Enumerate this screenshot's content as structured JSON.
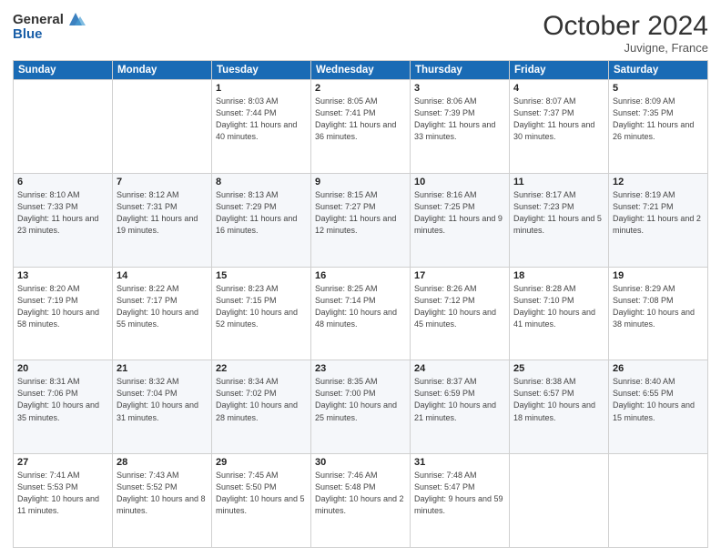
{
  "header": {
    "logo_line1": "General",
    "logo_line2": "Blue",
    "month": "October 2024",
    "location": "Juvigne, France"
  },
  "weekdays": [
    "Sunday",
    "Monday",
    "Tuesday",
    "Wednesday",
    "Thursday",
    "Friday",
    "Saturday"
  ],
  "weeks": [
    [
      {
        "day": "",
        "info": ""
      },
      {
        "day": "",
        "info": ""
      },
      {
        "day": "1",
        "info": "Sunrise: 8:03 AM\nSunset: 7:44 PM\nDaylight: 11 hours and 40 minutes."
      },
      {
        "day": "2",
        "info": "Sunrise: 8:05 AM\nSunset: 7:41 PM\nDaylight: 11 hours and 36 minutes."
      },
      {
        "day": "3",
        "info": "Sunrise: 8:06 AM\nSunset: 7:39 PM\nDaylight: 11 hours and 33 minutes."
      },
      {
        "day": "4",
        "info": "Sunrise: 8:07 AM\nSunset: 7:37 PM\nDaylight: 11 hours and 30 minutes."
      },
      {
        "day": "5",
        "info": "Sunrise: 8:09 AM\nSunset: 7:35 PM\nDaylight: 11 hours and 26 minutes."
      }
    ],
    [
      {
        "day": "6",
        "info": "Sunrise: 8:10 AM\nSunset: 7:33 PM\nDaylight: 11 hours and 23 minutes."
      },
      {
        "day": "7",
        "info": "Sunrise: 8:12 AM\nSunset: 7:31 PM\nDaylight: 11 hours and 19 minutes."
      },
      {
        "day": "8",
        "info": "Sunrise: 8:13 AM\nSunset: 7:29 PM\nDaylight: 11 hours and 16 minutes."
      },
      {
        "day": "9",
        "info": "Sunrise: 8:15 AM\nSunset: 7:27 PM\nDaylight: 11 hours and 12 minutes."
      },
      {
        "day": "10",
        "info": "Sunrise: 8:16 AM\nSunset: 7:25 PM\nDaylight: 11 hours and 9 minutes."
      },
      {
        "day": "11",
        "info": "Sunrise: 8:17 AM\nSunset: 7:23 PM\nDaylight: 11 hours and 5 minutes."
      },
      {
        "day": "12",
        "info": "Sunrise: 8:19 AM\nSunset: 7:21 PM\nDaylight: 11 hours and 2 minutes."
      }
    ],
    [
      {
        "day": "13",
        "info": "Sunrise: 8:20 AM\nSunset: 7:19 PM\nDaylight: 10 hours and 58 minutes."
      },
      {
        "day": "14",
        "info": "Sunrise: 8:22 AM\nSunset: 7:17 PM\nDaylight: 10 hours and 55 minutes."
      },
      {
        "day": "15",
        "info": "Sunrise: 8:23 AM\nSunset: 7:15 PM\nDaylight: 10 hours and 52 minutes."
      },
      {
        "day": "16",
        "info": "Sunrise: 8:25 AM\nSunset: 7:14 PM\nDaylight: 10 hours and 48 minutes."
      },
      {
        "day": "17",
        "info": "Sunrise: 8:26 AM\nSunset: 7:12 PM\nDaylight: 10 hours and 45 minutes."
      },
      {
        "day": "18",
        "info": "Sunrise: 8:28 AM\nSunset: 7:10 PM\nDaylight: 10 hours and 41 minutes."
      },
      {
        "day": "19",
        "info": "Sunrise: 8:29 AM\nSunset: 7:08 PM\nDaylight: 10 hours and 38 minutes."
      }
    ],
    [
      {
        "day": "20",
        "info": "Sunrise: 8:31 AM\nSunset: 7:06 PM\nDaylight: 10 hours and 35 minutes."
      },
      {
        "day": "21",
        "info": "Sunrise: 8:32 AM\nSunset: 7:04 PM\nDaylight: 10 hours and 31 minutes."
      },
      {
        "day": "22",
        "info": "Sunrise: 8:34 AM\nSunset: 7:02 PM\nDaylight: 10 hours and 28 minutes."
      },
      {
        "day": "23",
        "info": "Sunrise: 8:35 AM\nSunset: 7:00 PM\nDaylight: 10 hours and 25 minutes."
      },
      {
        "day": "24",
        "info": "Sunrise: 8:37 AM\nSunset: 6:59 PM\nDaylight: 10 hours and 21 minutes."
      },
      {
        "day": "25",
        "info": "Sunrise: 8:38 AM\nSunset: 6:57 PM\nDaylight: 10 hours and 18 minutes."
      },
      {
        "day": "26",
        "info": "Sunrise: 8:40 AM\nSunset: 6:55 PM\nDaylight: 10 hours and 15 minutes."
      }
    ],
    [
      {
        "day": "27",
        "info": "Sunrise: 7:41 AM\nSunset: 5:53 PM\nDaylight: 10 hours and 11 minutes."
      },
      {
        "day": "28",
        "info": "Sunrise: 7:43 AM\nSunset: 5:52 PM\nDaylight: 10 hours and 8 minutes."
      },
      {
        "day": "29",
        "info": "Sunrise: 7:45 AM\nSunset: 5:50 PM\nDaylight: 10 hours and 5 minutes."
      },
      {
        "day": "30",
        "info": "Sunrise: 7:46 AM\nSunset: 5:48 PM\nDaylight: 10 hours and 2 minutes."
      },
      {
        "day": "31",
        "info": "Sunrise: 7:48 AM\nSunset: 5:47 PM\nDaylight: 9 hours and 59 minutes."
      },
      {
        "day": "",
        "info": ""
      },
      {
        "day": "",
        "info": ""
      }
    ]
  ]
}
